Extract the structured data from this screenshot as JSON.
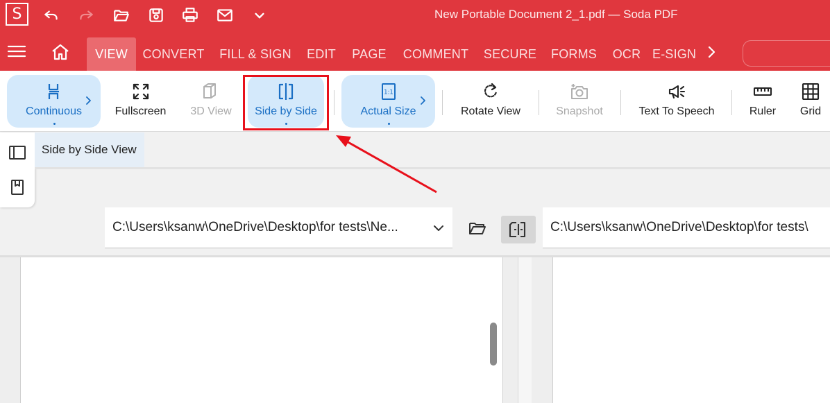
{
  "titlebar": {
    "logo_letter": "S",
    "document_title": "New Portable Document 2_1.pdf  —  Soda PDF",
    "icons": [
      "undo-icon",
      "redo-icon",
      "open-folder-icon",
      "save-icon",
      "print-icon",
      "email-icon",
      "chevron-down-icon"
    ]
  },
  "ribbon": {
    "tabs": [
      "VIEW",
      "CONVERT",
      "FILL & SIGN",
      "EDIT",
      "PAGE",
      "COMMENT",
      "SECURE",
      "FORMS",
      "OCR",
      "E-SIGN"
    ],
    "active_tab": "VIEW"
  },
  "toolbar": {
    "continuous": "Continuous",
    "fullscreen": "Fullscreen",
    "view_3d": "3D View",
    "side_by_side": "Side by Side",
    "actual_size": "Actual Size",
    "rotate_view": "Rotate View",
    "snapshot": "Snapshot",
    "text_to_speech": "Text To Speech",
    "ruler": "Ruler",
    "grid": "Grid",
    "actual_size_glyph": "1:1"
  },
  "document_tabs": [
    {
      "label": "Side by Side View"
    }
  ],
  "compare": {
    "left_path": "C:\\Users\\ksanw\\OneDrive\\Desktop\\for tests\\Ne...",
    "right_path": "C:\\Users\\ksanw\\OneDrive\\Desktop\\for tests\\"
  },
  "colors": {
    "brand_red": "#e0373e",
    "active_tab": "#ea6a6f",
    "accent_blue": "#1a6fc4",
    "selected_bg": "#d4e9fb",
    "annotation_red": "#e8101b"
  }
}
